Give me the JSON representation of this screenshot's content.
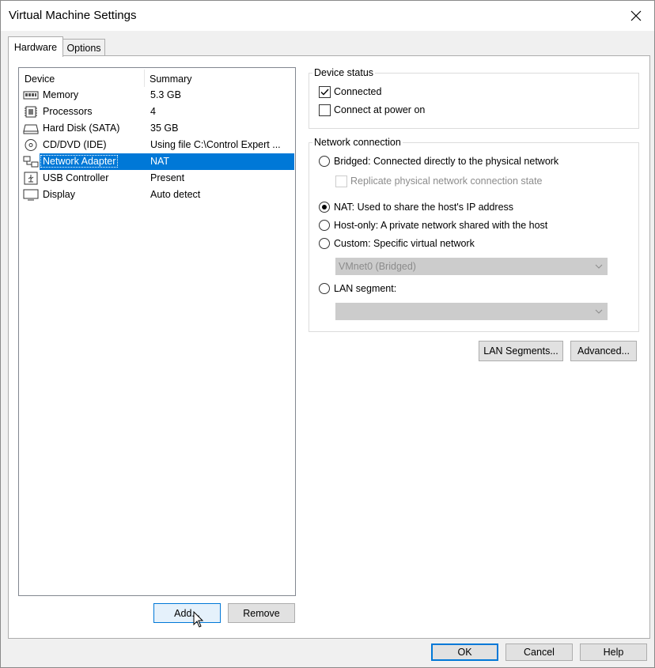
{
  "window": {
    "title": "Virtual Machine Settings"
  },
  "tabs": [
    {
      "label": "Hardware",
      "active": true
    },
    {
      "label": "Options",
      "active": false
    }
  ],
  "device_list": {
    "columns": [
      "Device",
      "Summary"
    ],
    "rows": [
      {
        "icon": "memory-icon",
        "device": "Memory",
        "summary": "5.3 GB"
      },
      {
        "icon": "processor-icon",
        "device": "Processors",
        "summary": "4"
      },
      {
        "icon": "hard-disk-icon",
        "device": "Hard Disk (SATA)",
        "summary": "35 GB"
      },
      {
        "icon": "cd-dvd-icon",
        "device": "CD/DVD (IDE)",
        "summary": "Using file C:\\Control Expert ..."
      },
      {
        "icon": "network-adapter-icon",
        "device": "Network Adapter",
        "summary": "NAT",
        "selected": true
      },
      {
        "icon": "usb-controller-icon",
        "device": "USB Controller",
        "summary": "Present"
      },
      {
        "icon": "display-icon",
        "device": "Display",
        "summary": "Auto detect"
      }
    ]
  },
  "list_buttons": {
    "add": "Add...",
    "remove": "Remove"
  },
  "device_status": {
    "title": "Device status",
    "connected": {
      "label": "Connected",
      "checked": true
    },
    "connect_at_power_on": {
      "label": "Connect at power on",
      "checked": false
    }
  },
  "network_connection": {
    "title": "Network connection",
    "bridged": {
      "label": "Bridged: Connected directly to the physical network",
      "selected": false
    },
    "replicate": {
      "label": "Replicate physical network connection state",
      "checked": false,
      "enabled": false
    },
    "nat": {
      "label": "NAT: Used to share the host's IP address",
      "selected": true
    },
    "host_only": {
      "label": "Host-only: A private network shared with the host",
      "selected": false
    },
    "custom": {
      "label": "Custom: Specific virtual network",
      "selected": false
    },
    "custom_select_value": "VMnet0 (Bridged)",
    "lan_segment": {
      "label": "LAN segment:",
      "selected": false
    },
    "lan_segment_select_value": ""
  },
  "network_buttons": {
    "lan_segments": "LAN Segments...",
    "advanced": "Advanced..."
  },
  "footer": {
    "ok": "OK",
    "cancel": "Cancel",
    "help": "Help"
  },
  "colors": {
    "selection": "#0078d7",
    "background": "#f0f0f0",
    "disabled_text": "#8c8c8c"
  }
}
